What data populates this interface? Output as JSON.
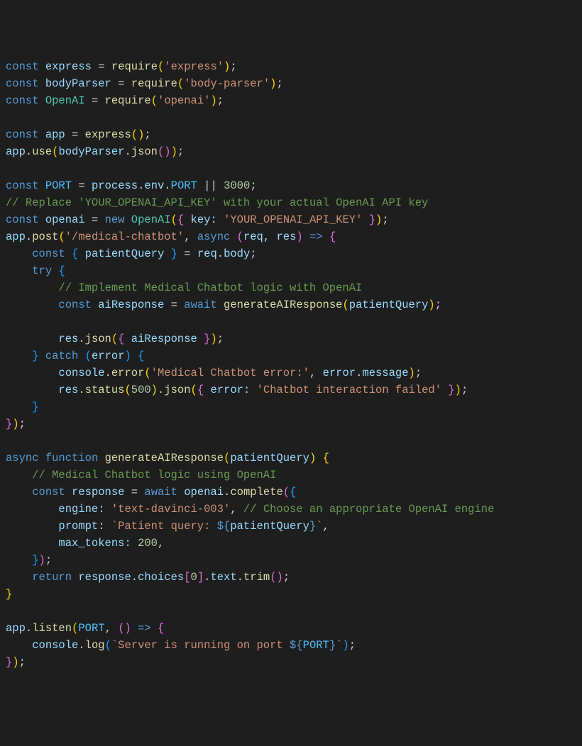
{
  "code": {
    "tokens": [
      [
        [
          "kw",
          "const"
        ],
        [
          "pun",
          " "
        ],
        [
          "var",
          "express"
        ],
        [
          "pun",
          " "
        ],
        [
          "op",
          "="
        ],
        [
          "pun",
          " "
        ],
        [
          "fn",
          "require"
        ],
        [
          "brc",
          "("
        ],
        [
          "str",
          "'express'"
        ],
        [
          "brc",
          ")"
        ],
        [
          "pun",
          ";"
        ]
      ],
      [
        [
          "kw",
          "const"
        ],
        [
          "pun",
          " "
        ],
        [
          "var",
          "bodyParser"
        ],
        [
          "pun",
          " "
        ],
        [
          "op",
          "="
        ],
        [
          "pun",
          " "
        ],
        [
          "fn",
          "require"
        ],
        [
          "brc",
          "("
        ],
        [
          "str",
          "'body-parser'"
        ],
        [
          "brc",
          ")"
        ],
        [
          "pun",
          ";"
        ]
      ],
      [
        [
          "kw",
          "const"
        ],
        [
          "pun",
          " "
        ],
        [
          "cls",
          "OpenAI"
        ],
        [
          "pun",
          " "
        ],
        [
          "op",
          "="
        ],
        [
          "pun",
          " "
        ],
        [
          "fn",
          "require"
        ],
        [
          "brc",
          "("
        ],
        [
          "str",
          "'openai'"
        ],
        [
          "brc",
          ")"
        ],
        [
          "pun",
          ";"
        ]
      ],
      [],
      [
        [
          "kw",
          "const"
        ],
        [
          "pun",
          " "
        ],
        [
          "var",
          "app"
        ],
        [
          "pun",
          " "
        ],
        [
          "op",
          "="
        ],
        [
          "pun",
          " "
        ],
        [
          "fn",
          "express"
        ],
        [
          "brc",
          "("
        ],
        [
          "brc",
          ")"
        ],
        [
          "pun",
          ";"
        ]
      ],
      [
        [
          "var",
          "app"
        ],
        [
          "pun",
          "."
        ],
        [
          "fn",
          "use"
        ],
        [
          "brc",
          "("
        ],
        [
          "var",
          "bodyParser"
        ],
        [
          "pun",
          "."
        ],
        [
          "fn",
          "json"
        ],
        [
          "brc2",
          "("
        ],
        [
          "brc2",
          ")"
        ],
        [
          "brc",
          ")"
        ],
        [
          "pun",
          ";"
        ]
      ],
      [],
      [
        [
          "kw",
          "const"
        ],
        [
          "pun",
          " "
        ],
        [
          "const",
          "PORT"
        ],
        [
          "pun",
          " "
        ],
        [
          "op",
          "="
        ],
        [
          "pun",
          " "
        ],
        [
          "var",
          "process"
        ],
        [
          "pun",
          "."
        ],
        [
          "var",
          "env"
        ],
        [
          "pun",
          "."
        ],
        [
          "const",
          "PORT"
        ],
        [
          "pun",
          " "
        ],
        [
          "op",
          "||"
        ],
        [
          "pun",
          " "
        ],
        [
          "num",
          "3000"
        ],
        [
          "pun",
          ";"
        ]
      ],
      [
        [
          "cmt",
          "// Replace 'YOUR_OPENAI_API_KEY' with your actual OpenAI API key"
        ]
      ],
      [
        [
          "kw",
          "const"
        ],
        [
          "pun",
          " "
        ],
        [
          "var",
          "openai"
        ],
        [
          "pun",
          " "
        ],
        [
          "op",
          "="
        ],
        [
          "pun",
          " "
        ],
        [
          "kw",
          "new"
        ],
        [
          "pun",
          " "
        ],
        [
          "cls",
          "OpenAI"
        ],
        [
          "brc",
          "("
        ],
        [
          "brc2",
          "{"
        ],
        [
          "pun",
          " "
        ],
        [
          "var",
          "key"
        ],
        [
          "pun",
          ":"
        ],
        [
          "pun",
          " "
        ],
        [
          "str",
          "'YOUR_OPENAI_API_KEY'"
        ],
        [
          "pun",
          " "
        ],
        [
          "brc2",
          "}"
        ],
        [
          "brc",
          ")"
        ],
        [
          "pun",
          ";"
        ]
      ],
      [
        [
          "var",
          "app"
        ],
        [
          "pun",
          "."
        ],
        [
          "fn",
          "post"
        ],
        [
          "brc",
          "("
        ],
        [
          "str",
          "'/medical-chatbot'"
        ],
        [
          "pun",
          ","
        ],
        [
          "pun",
          " "
        ],
        [
          "kw",
          "async"
        ],
        [
          "pun",
          " "
        ],
        [
          "brc2",
          "("
        ],
        [
          "var",
          "req"
        ],
        [
          "pun",
          ","
        ],
        [
          "pun",
          " "
        ],
        [
          "var",
          "res"
        ],
        [
          "brc2",
          ")"
        ],
        [
          "pun",
          " "
        ],
        [
          "kw",
          "=>"
        ],
        [
          "pun",
          " "
        ],
        [
          "brc2",
          "{"
        ]
      ],
      [
        [
          "pun",
          "    "
        ],
        [
          "kw",
          "const"
        ],
        [
          "pun",
          " "
        ],
        [
          "brc3",
          "{"
        ],
        [
          "pun",
          " "
        ],
        [
          "var",
          "patientQuery"
        ],
        [
          "pun",
          " "
        ],
        [
          "brc3",
          "}"
        ],
        [
          "pun",
          " "
        ],
        [
          "op",
          "="
        ],
        [
          "pun",
          " "
        ],
        [
          "var",
          "req"
        ],
        [
          "pun",
          "."
        ],
        [
          "var",
          "body"
        ],
        [
          "pun",
          ";"
        ]
      ],
      [
        [
          "pun",
          "    "
        ],
        [
          "kw",
          "try"
        ],
        [
          "pun",
          " "
        ],
        [
          "brc3",
          "{"
        ]
      ],
      [
        [
          "pun",
          "        "
        ],
        [
          "cmt",
          "// Implement Medical Chatbot logic with OpenAI"
        ]
      ],
      [
        [
          "pun",
          "        "
        ],
        [
          "kw",
          "const"
        ],
        [
          "pun",
          " "
        ],
        [
          "var",
          "aiResponse"
        ],
        [
          "pun",
          " "
        ],
        [
          "op",
          "="
        ],
        [
          "pun",
          " "
        ],
        [
          "kw",
          "await"
        ],
        [
          "pun",
          " "
        ],
        [
          "fn",
          "generateAIResponse"
        ],
        [
          "brc",
          "("
        ],
        [
          "var",
          "patientQuery"
        ],
        [
          "brc",
          ")"
        ],
        [
          "pun",
          ";"
        ]
      ],
      [],
      [
        [
          "pun",
          "        "
        ],
        [
          "var",
          "res"
        ],
        [
          "pun",
          "."
        ],
        [
          "fn",
          "json"
        ],
        [
          "brc",
          "("
        ],
        [
          "brc2",
          "{"
        ],
        [
          "pun",
          " "
        ],
        [
          "var",
          "aiResponse"
        ],
        [
          "pun",
          " "
        ],
        [
          "brc2",
          "}"
        ],
        [
          "brc",
          ")"
        ],
        [
          "pun",
          ";"
        ]
      ],
      [
        [
          "pun",
          "    "
        ],
        [
          "brc3",
          "}"
        ],
        [
          "pun",
          " "
        ],
        [
          "kw",
          "catch"
        ],
        [
          "pun",
          " "
        ],
        [
          "brc3",
          "("
        ],
        [
          "var",
          "error"
        ],
        [
          "brc3",
          ")"
        ],
        [
          "pun",
          " "
        ],
        [
          "brc3",
          "{"
        ]
      ],
      [
        [
          "pun",
          "        "
        ],
        [
          "var",
          "console"
        ],
        [
          "pun",
          "."
        ],
        [
          "fn",
          "error"
        ],
        [
          "brc",
          "("
        ],
        [
          "str",
          "'Medical Chatbot error:'"
        ],
        [
          "pun",
          ","
        ],
        [
          "pun",
          " "
        ],
        [
          "var",
          "error"
        ],
        [
          "pun",
          "."
        ],
        [
          "var",
          "message"
        ],
        [
          "brc",
          ")"
        ],
        [
          "pun",
          ";"
        ]
      ],
      [
        [
          "pun",
          "        "
        ],
        [
          "var",
          "res"
        ],
        [
          "pun",
          "."
        ],
        [
          "fn",
          "status"
        ],
        [
          "brc",
          "("
        ],
        [
          "num",
          "500"
        ],
        [
          "brc",
          ")"
        ],
        [
          "pun",
          "."
        ],
        [
          "fn",
          "json"
        ],
        [
          "brc",
          "("
        ],
        [
          "brc2",
          "{"
        ],
        [
          "pun",
          " "
        ],
        [
          "var",
          "error"
        ],
        [
          "pun",
          ":"
        ],
        [
          "pun",
          " "
        ],
        [
          "str",
          "'Chatbot interaction failed'"
        ],
        [
          "pun",
          " "
        ],
        [
          "brc2",
          "}"
        ],
        [
          "brc",
          ")"
        ],
        [
          "pun",
          ";"
        ]
      ],
      [
        [
          "pun",
          "    "
        ],
        [
          "brc3",
          "}"
        ]
      ],
      [
        [
          "brc2",
          "}"
        ],
        [
          "brc",
          ")"
        ],
        [
          "pun",
          ";"
        ]
      ],
      [],
      [
        [
          "kw",
          "async"
        ],
        [
          "pun",
          " "
        ],
        [
          "kw",
          "function"
        ],
        [
          "pun",
          " "
        ],
        [
          "fn",
          "generateAIResponse"
        ],
        [
          "brc",
          "("
        ],
        [
          "var",
          "patientQuery"
        ],
        [
          "brc",
          ")"
        ],
        [
          "pun",
          " "
        ],
        [
          "brc",
          "{"
        ]
      ],
      [
        [
          "pun",
          "    "
        ],
        [
          "cmt",
          "// Medical Chatbot logic using OpenAI"
        ]
      ],
      [
        [
          "pun",
          "    "
        ],
        [
          "kw",
          "const"
        ],
        [
          "pun",
          " "
        ],
        [
          "var",
          "response"
        ],
        [
          "pun",
          " "
        ],
        [
          "op",
          "="
        ],
        [
          "pun",
          " "
        ],
        [
          "kw",
          "await"
        ],
        [
          "pun",
          " "
        ],
        [
          "var",
          "openai"
        ],
        [
          "pun",
          "."
        ],
        [
          "fn",
          "complete"
        ],
        [
          "brc2",
          "("
        ],
        [
          "brc3",
          "{"
        ]
      ],
      [
        [
          "pun",
          "        "
        ],
        [
          "var",
          "engine"
        ],
        [
          "pun",
          ":"
        ],
        [
          "pun",
          " "
        ],
        [
          "str",
          "'text-davinci-003'"
        ],
        [
          "pun",
          ","
        ],
        [
          "pun",
          " "
        ],
        [
          "cmt",
          "// Choose an appropriate OpenAI engine"
        ]
      ],
      [
        [
          "pun",
          "        "
        ],
        [
          "var",
          "prompt"
        ],
        [
          "pun",
          ":"
        ],
        [
          "pun",
          " "
        ],
        [
          "str",
          "`Patient query: "
        ],
        [
          "kw",
          "${"
        ],
        [
          "var",
          "patientQuery"
        ],
        [
          "kw",
          "}"
        ],
        [
          "str",
          "`"
        ],
        [
          "pun",
          ","
        ]
      ],
      [
        [
          "pun",
          "        "
        ],
        [
          "var",
          "max_tokens"
        ],
        [
          "pun",
          ":"
        ],
        [
          "pun",
          " "
        ],
        [
          "num",
          "200"
        ],
        [
          "pun",
          ","
        ]
      ],
      [
        [
          "pun",
          "    "
        ],
        [
          "brc3",
          "}"
        ],
        [
          "brc2",
          ")"
        ],
        [
          "pun",
          ";"
        ]
      ],
      [
        [
          "pun",
          "    "
        ],
        [
          "kw",
          "return"
        ],
        [
          "pun",
          " "
        ],
        [
          "var",
          "response"
        ],
        [
          "pun",
          "."
        ],
        [
          "var",
          "choices"
        ],
        [
          "brc2",
          "["
        ],
        [
          "num",
          "0"
        ],
        [
          "brc2",
          "]"
        ],
        [
          "pun",
          "."
        ],
        [
          "var",
          "text"
        ],
        [
          "pun",
          "."
        ],
        [
          "fn",
          "trim"
        ],
        [
          "brc2",
          "("
        ],
        [
          "brc2",
          ")"
        ],
        [
          "pun",
          ";"
        ]
      ],
      [
        [
          "brc",
          "}"
        ]
      ],
      [],
      [
        [
          "var",
          "app"
        ],
        [
          "pun",
          "."
        ],
        [
          "fn",
          "listen"
        ],
        [
          "brc",
          "("
        ],
        [
          "const",
          "PORT"
        ],
        [
          "pun",
          ","
        ],
        [
          "pun",
          " "
        ],
        [
          "brc2",
          "("
        ],
        [
          "brc2",
          ")"
        ],
        [
          "pun",
          " "
        ],
        [
          "kw",
          "=>"
        ],
        [
          "pun",
          " "
        ],
        [
          "brc2",
          "{"
        ]
      ],
      [
        [
          "pun",
          "    "
        ],
        [
          "var",
          "console"
        ],
        [
          "pun",
          "."
        ],
        [
          "fn",
          "log"
        ],
        [
          "brc3",
          "("
        ],
        [
          "str",
          "`Server is running on port "
        ],
        [
          "kw",
          "${"
        ],
        [
          "const",
          "PORT"
        ],
        [
          "kw",
          "}"
        ],
        [
          "str",
          "`"
        ],
        [
          "brc3",
          ")"
        ],
        [
          "pun",
          ";"
        ]
      ],
      [
        [
          "brc2",
          "}"
        ],
        [
          "brc",
          ")"
        ],
        [
          "pun",
          ";"
        ]
      ]
    ]
  }
}
